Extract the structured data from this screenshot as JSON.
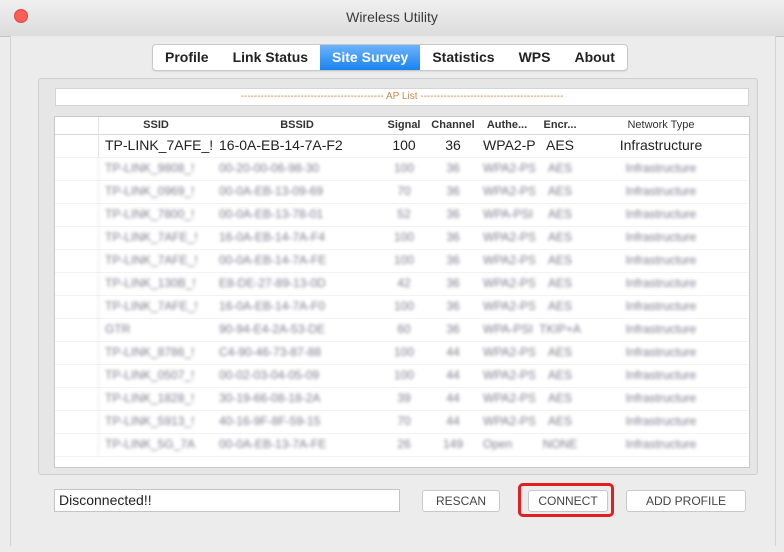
{
  "window": {
    "title": "Wireless Utility",
    "colors": {
      "close": "#fc5f57",
      "active_tab": "#1a83f0",
      "highlight": "#e01f1f",
      "list_header": "#c98a4a"
    }
  },
  "tabs": [
    {
      "label": "Profile",
      "active": false
    },
    {
      "label": "Link Status",
      "active": false
    },
    {
      "label": "Site Survey",
      "active": true
    },
    {
      "label": "Statistics",
      "active": false
    },
    {
      "label": "WPS",
      "active": false
    },
    {
      "label": "About",
      "active": false
    }
  ],
  "ap_list": {
    "header": "------------------------------------------- AP List -------------------------------------------",
    "columns": [
      "",
      "SSID",
      "BSSID",
      "Signal",
      "Channel",
      "Authe...",
      "Encr...",
      "Network Type"
    ],
    "rows": [
      [
        "",
        "TP-LINK_7AFE_!",
        "16-0A-EB-14-7A-F2",
        "100",
        "36",
        "WPA2-PS",
        "AES",
        "Infrastructure"
      ],
      [
        "",
        "TP-LINK_9808_!",
        "00-20-00-06-98-30",
        "100",
        "36",
        "WPA2-PS",
        "AES",
        "Infrastructure"
      ],
      [
        "",
        "TP-LINK_0969_!",
        "00-0A-EB-13-09-69",
        "70",
        "36",
        "WPA2-PS",
        "AES",
        "Infrastructure"
      ],
      [
        "",
        "TP-LINK_7800_!",
        "00-0A-EB-13-78-01",
        "52",
        "36",
        "WPA-PSI",
        "AES",
        "Infrastructure"
      ],
      [
        "",
        "TP-LINK_7AFE_!",
        "16-0A-EB-14-7A-F4",
        "100",
        "36",
        "WPA2-PS",
        "AES",
        "Infrastructure"
      ],
      [
        "",
        "TP-LINK_7AFE_!",
        "00-0A-EB-14-7A-FE",
        "100",
        "36",
        "WPA2-PS",
        "AES",
        "Infrastructure"
      ],
      [
        "",
        "TP-LINK_130B_!",
        "E8-DE-27-89-13-0D",
        "42",
        "36",
        "WPA2-PS",
        "AES",
        "Infrastructure"
      ],
      [
        "",
        "TP-LINK_7AFE_!",
        "16-0A-EB-14-7A-F0",
        "100",
        "36",
        "WPA2-PS",
        "AES",
        "Infrastructure"
      ],
      [
        "",
        "GTR",
        "90-94-E4-2A-53-DE",
        "60",
        "36",
        "WPA-PSI",
        "TKIP+A",
        "Infrastructure"
      ],
      [
        "",
        "TP-LINK_8786_!",
        "C4-90-46-73-87-88",
        "100",
        "44",
        "WPA2-PS",
        "AES",
        "Infrastructure"
      ],
      [
        "",
        "TP-LINK_0507_!",
        "00-02-03-04-05-09",
        "100",
        "44",
        "WPA2-PS",
        "AES",
        "Infrastructure"
      ],
      [
        "",
        "TP-LINK_1828_!",
        "30-19-66-08-18-2A",
        "39",
        "44",
        "WPA2-PS",
        "AES",
        "Infrastructure"
      ],
      [
        "",
        "TP-LINK_5913_!",
        "40-16-9F-8F-59-15",
        "70",
        "44",
        "WPA2-PS",
        "AES",
        "Infrastructure"
      ],
      [
        "",
        "TP-LINK_5G_7A",
        "00-0A-EB-13-7A-FE",
        "26",
        "149",
        "Open",
        "NONE",
        "Infrastructure"
      ]
    ]
  },
  "status": {
    "text": "Disconnected!!"
  },
  "buttons": {
    "rescan": "RESCAN",
    "connect": "CONNECT",
    "add_profile": "ADD PROFILE"
  }
}
